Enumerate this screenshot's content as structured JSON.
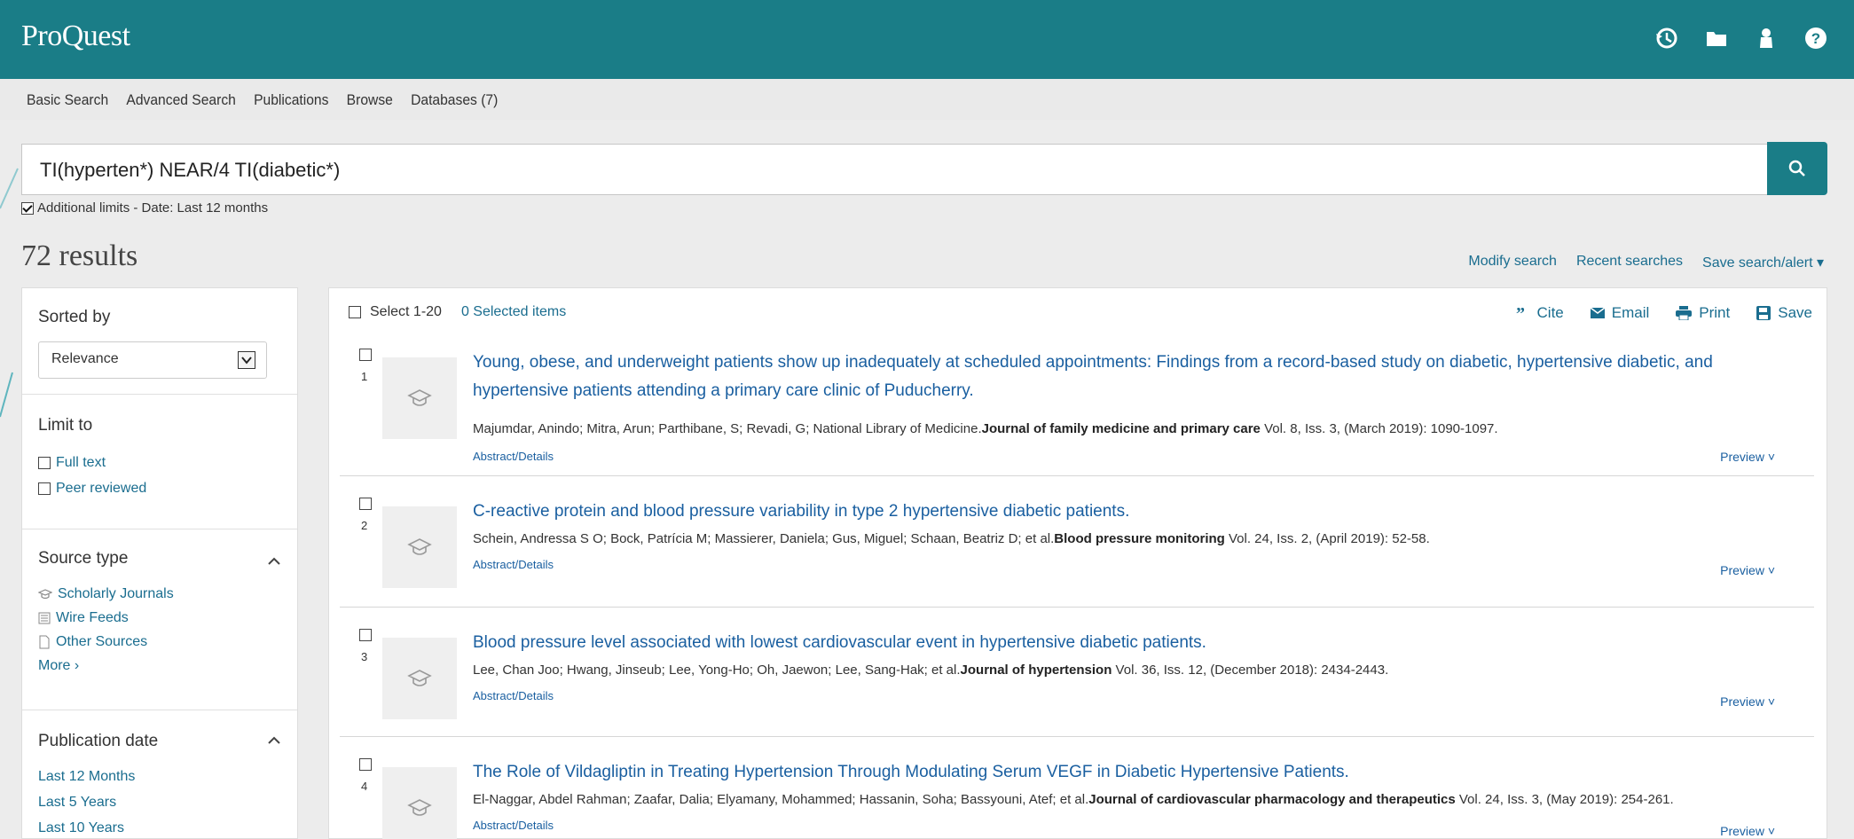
{
  "header": {
    "logo": "ProQuest"
  },
  "nav": [
    "Basic Search",
    "Advanced Search",
    "Publications",
    "Browse",
    "Databases (7)"
  ],
  "search": {
    "query": "TI(hyperten*) NEAR/4 TI(diabetic*)",
    "limits": "Additional limits - Date: Last 12 months"
  },
  "results": {
    "count": "72 results",
    "modify": "Modify search",
    "recent": "Recent searches",
    "save_alert": "Save search/alert ▾"
  },
  "sidebar": {
    "sorted_by": "Sorted by",
    "sort_value": "Relevance",
    "limit_to": "Limit to",
    "full_text": "Full text",
    "peer_reviewed": "Peer reviewed",
    "source_type": "Source type",
    "sources": [
      "Scholarly Journals",
      "Wire Feeds",
      "Other Sources"
    ],
    "more": "More ›",
    "pub_date": "Publication date",
    "dates": [
      "Last 12 Months",
      "Last 5 Years",
      "Last 10 Years"
    ]
  },
  "toolbar": {
    "select": "Select 1-20",
    "selected": "0 Selected items",
    "cite": "Cite",
    "email": "Email",
    "print": "Print",
    "save": "Save"
  },
  "items": [
    {
      "num": "1",
      "title": "Young, obese, and underweight patients show up inadequately at scheduled appointments: Findings from a record-based study on diabetic, hypertensive diabetic, and hypertensive patients attending a primary care clinic of Puducherry.",
      "authors": "Majumdar, Anindo; Mitra, Arun; Parthibane, S; Revadi, G; National Library of Medicine.",
      "journal": "Journal of family medicine and primary care",
      "details": " Vol. 8, Iss. 3,  (March 2019): 1090-1097."
    },
    {
      "num": "2",
      "title": "C-reactive protein and blood pressure variability in type 2 hypertensive diabetic patients.",
      "authors": "Schein, Andressa S O; Bock, Patrícia M; Massierer, Daniela; Gus, Miguel; Schaan, Beatriz D; et al.",
      "journal": "Blood pressure monitoring",
      "details": " Vol. 24, Iss. 2,  (April 2019): 52-58."
    },
    {
      "num": "3",
      "title": "Blood pressure level associated with lowest cardiovascular event in hypertensive diabetic patients.",
      "authors": "Lee, Chan Joo; Hwang, Jinseub; Lee, Yong-Ho; Oh, Jaewon; Lee, Sang-Hak; et al.",
      "journal": "Journal of hypertension",
      "details": " Vol. 36, Iss. 12,  (December 2018): 2434-2443."
    },
    {
      "num": "4",
      "title": "The Role of Vildagliptin in Treating Hypertension Through Modulating Serum VEGF in Diabetic Hypertensive Patients.",
      "authors": "El-Naggar, Abdel Rahman; Zaafar, Dalia; Elyamany, Mohammed; Hassanin, Soha; Bassyouni, Atef; et al.",
      "journal": "Journal of cardiovascular pharmacology and therapeutics",
      "details": " Vol. 24, Iss. 3,  (May 2019): 254-261."
    }
  ],
  "item_links": {
    "abstract": "Abstract/Details",
    "preview": "Preview ˅"
  },
  "colors": {
    "brand": "#1a7d87",
    "link": "#1a5fa0"
  }
}
